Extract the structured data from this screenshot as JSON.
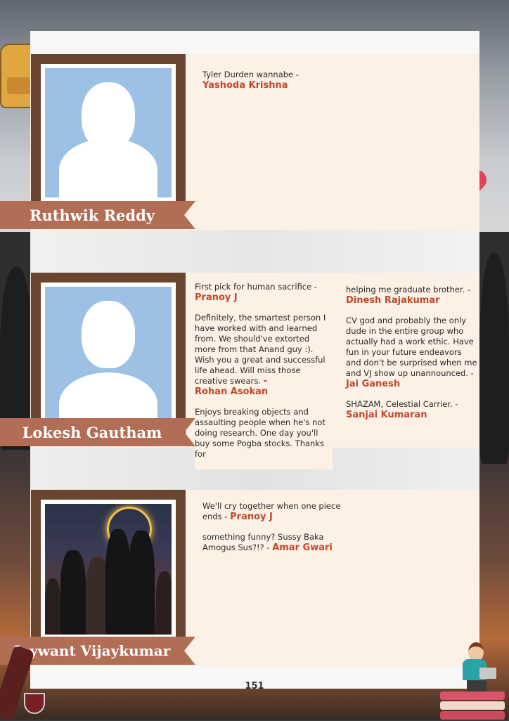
{
  "page_number": "151",
  "students": [
    {
      "name": "Ruthwik Reddy",
      "notes": [
        {
          "text": "Tyler Durden wannabe -",
          "author": "Yashoda Krishna"
        }
      ]
    },
    {
      "name": "Lokesh Gautham",
      "notes_col1": [
        {
          "text": "First pick for human sacrifice -",
          "author": "Pranoy J"
        },
        {
          "text": "Definitely, the smartest person I have worked with and learned from. We should've extorted more from that Anand guy :). Wish you a great and successful life ahead. Will miss those creative swears.",
          "author": "Rohan Asokan"
        },
        {
          "text": "Enjoys breaking objects and assaulting people when he's not doing research. One day you'll buy some Pogba stocks. Thanks for"
        }
      ],
      "notes_col2": [
        {
          "text": "helping me graduate brother. -",
          "author": "Dinesh Rajakumar"
        },
        {
          "text": "CV god and probably the only dude in the entire group who actually had a work ethic. Have fun in your future endeavors and don't be surprised when me and VJ show up unannounced. -",
          "author": "Jai Ganesh"
        },
        {
          "text": "SHAZAM,  Celestial Carrier. -",
          "author": "Sanjai Kumaran"
        }
      ]
    },
    {
      "name": "Jaywant Vijaykumar",
      "notes": [
        {
          "text": "We'll cry together when one piece ends -",
          "author": "Pranoy J"
        },
        {
          "text": "something funny? Sussy Baka Amogus Sus?!? -",
          "author": "Amar Gwari"
        }
      ]
    }
  ]
}
